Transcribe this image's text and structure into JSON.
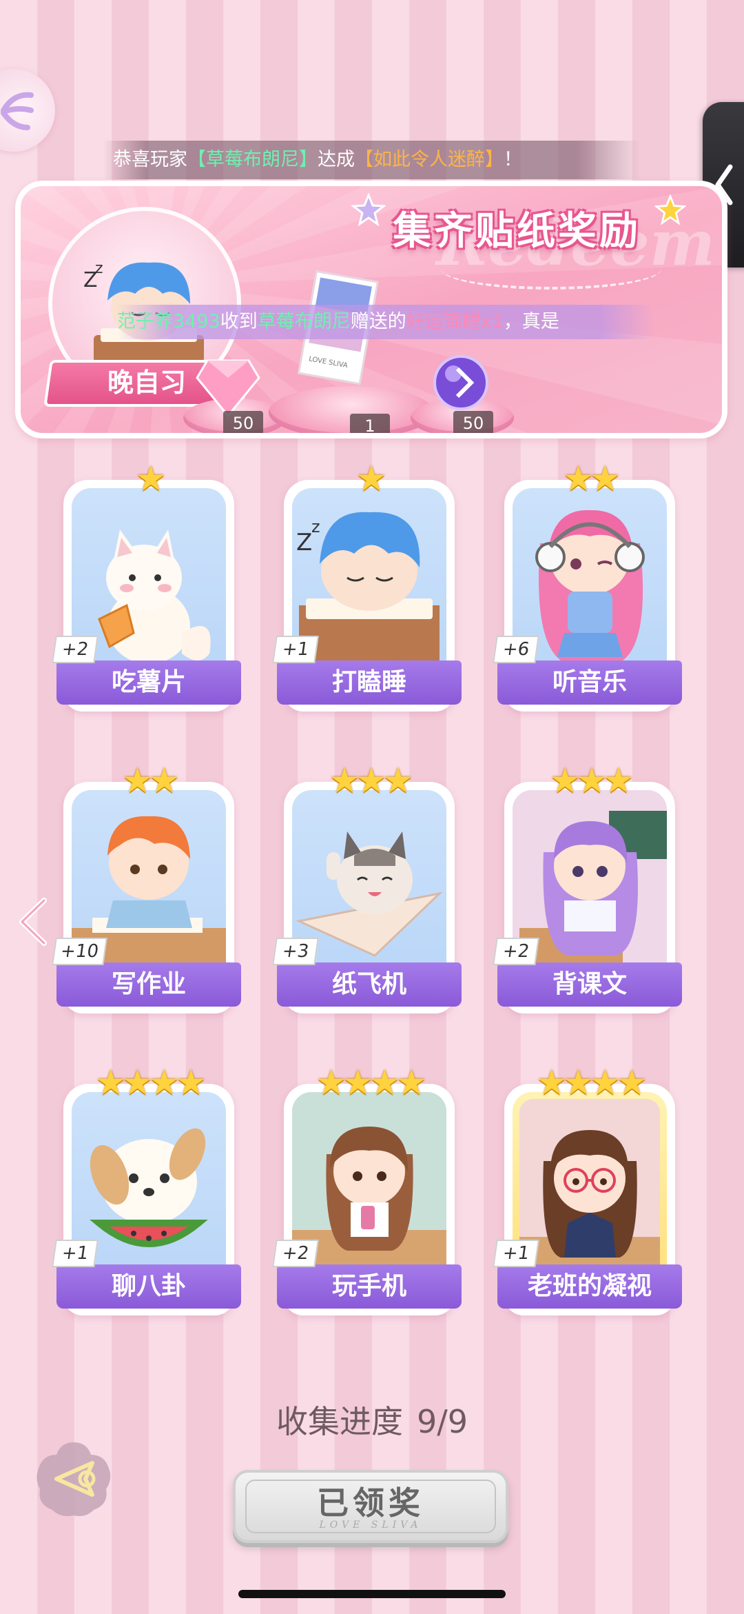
{
  "announcement": {
    "prefix": "恭喜玩家",
    "player": "【草莓布朗尼】",
    "mid": "达成",
    "achievement": "【如此令人迷醉】",
    "suffix": "！"
  },
  "gift_ticker": {
    "player": "范子养3493",
    "mid": "收到",
    "sender": "草莓布朗尼",
    "verb": "赠送的",
    "item": "好运锦鲤x1",
    "suffix": "，真是"
  },
  "banner": {
    "title": "集齐贴纸奖励",
    "watermark": "Redeem",
    "sticker_name": "晚自习",
    "rewards": [
      {
        "icon": "pink-diamond-icon",
        "count": "50"
      },
      {
        "icon": "photo-card-icon",
        "count": "1"
      },
      {
        "icon": "purple-orb-icon",
        "count": "50"
      }
    ]
  },
  "stickers": [
    {
      "name": "吃薯片",
      "bonus": "+2",
      "stars": 1,
      "art": "white-fox-chips"
    },
    {
      "name": "打瞌睡",
      "bonus": "+1",
      "stars": 1,
      "art": "boy-sleeping"
    },
    {
      "name": "听音乐",
      "bonus": "+6",
      "stars": 2,
      "art": "girl-headphones"
    },
    {
      "name": "写作业",
      "bonus": "+10",
      "stars": 2,
      "art": "boy-homework"
    },
    {
      "name": "纸飞机",
      "bonus": "+3",
      "stars": 3,
      "art": "cat-paper-plane"
    },
    {
      "name": "背课文",
      "bonus": "+2",
      "stars": 3,
      "art": "girl-reading"
    },
    {
      "name": "聊八卦",
      "bonus": "+1",
      "stars": 4,
      "art": "dog-watermelon"
    },
    {
      "name": "玩手机",
      "bonus": "+2",
      "stars": 4,
      "art": "girl-phone"
    },
    {
      "name": "老班的凝视",
      "bonus": "+1",
      "stars": 4,
      "art": "teacher-glasses",
      "gold": true
    }
  ],
  "progress": {
    "label": "收集进度",
    "value": "9/9"
  },
  "claim_button": {
    "label": "已领奖",
    "sub": "LOVE SLIVA"
  },
  "colors": {
    "accent_purple": "#8a5ad8",
    "banner_pink": "#f8a6c1",
    "star_gold": "#ffd33d"
  }
}
